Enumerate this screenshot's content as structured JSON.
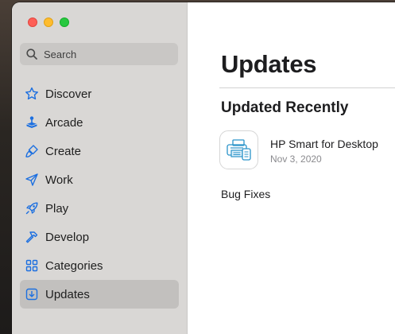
{
  "colors": {
    "accent": "#1c6fe0",
    "sidebar_bg": "#d9d7d5",
    "selected_bg": "#c2c0be",
    "traffic_red": "#fe5f57",
    "traffic_yellow": "#febc2e",
    "traffic_green": "#28c840"
  },
  "search": {
    "label": "Search",
    "icon": "search-icon"
  },
  "sidebar": {
    "items": [
      {
        "label": "Discover",
        "icon": "star-icon",
        "selected": false
      },
      {
        "label": "Arcade",
        "icon": "joystick-icon",
        "selected": false
      },
      {
        "label": "Create",
        "icon": "paintbrush-icon",
        "selected": false
      },
      {
        "label": "Work",
        "icon": "paperplane-icon",
        "selected": false
      },
      {
        "label": "Play",
        "icon": "rocket-icon",
        "selected": false
      },
      {
        "label": "Develop",
        "icon": "hammer-icon",
        "selected": false
      },
      {
        "label": "Categories",
        "icon": "grid-icon",
        "selected": false
      },
      {
        "label": "Updates",
        "icon": "download-icon",
        "selected": true
      }
    ]
  },
  "main": {
    "title": "Updates",
    "section_title": "Updated Recently",
    "app": {
      "name": "HP Smart for Desktop",
      "date": "Nov 3, 2020",
      "icon": "printer-icon",
      "notes": "Bug Fixes"
    }
  }
}
